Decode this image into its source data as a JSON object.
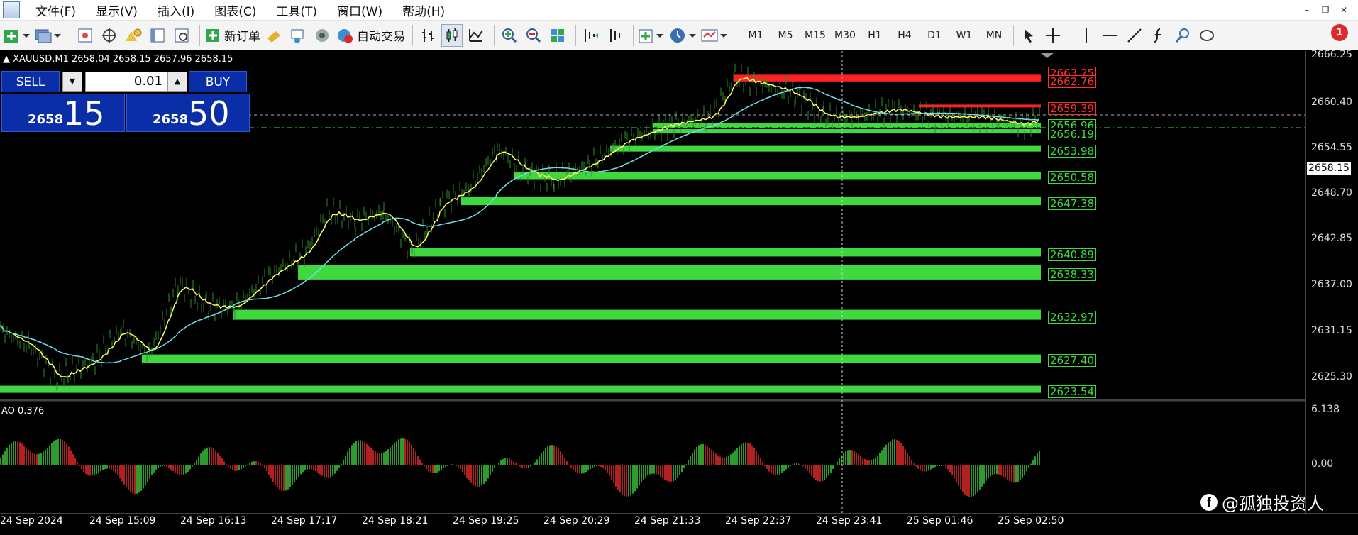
{
  "menu": {
    "items": [
      "文件(F)",
      "显示(V)",
      "插入(I)",
      "图表(C)",
      "工具(T)",
      "窗口(W)",
      "帮助(H)"
    ]
  },
  "toolbar": {
    "new_order_label": "新订单",
    "auto_trading_label": "自动交易",
    "timeframes": [
      "M1",
      "M5",
      "M15",
      "M30",
      "H1",
      "H4",
      "D1",
      "W1",
      "MN"
    ],
    "notification_count": "1"
  },
  "chart": {
    "symbol_line": "XAUUSD,M1  2658.04 2658.15 2657.96 2658.15",
    "current_price": "2658.15",
    "price_axis": [
      "2666.25",
      "2660.40",
      "2654.55",
      "2648.70",
      "2642.85",
      "2637.00",
      "2631.15",
      "2625.30"
    ],
    "ao_axis": [
      "6.138",
      "0.00"
    ],
    "ao_label": "AO 0.376",
    "time_axis": [
      "24 Sep 2024",
      "24 Sep 15:09",
      "24 Sep 16:13",
      "24 Sep 17:17",
      "24 Sep 18:21",
      "24 Sep 19:25",
      "24 Sep 20:29",
      "24 Sep 21:33",
      "24 Sep 22:37",
      "24 Sep 23:41",
      "25 Sep 01:46",
      "25 Sep 02:50"
    ],
    "support_levels": [
      "2653.98",
      "2650.58",
      "2647.38",
      "2640.89",
      "2638.33",
      "2632.97",
      "2627.40",
      "2623.54",
      "2656.96",
      "2656.19"
    ],
    "resistance_levels": [
      "2663.25",
      "2662.76",
      "2659.39"
    ],
    "colors": {
      "support": "#3fd93f",
      "resistance": "#ff2020",
      "ma_fast": "#ffff66",
      "ma_slow": "#6fe0e6",
      "candles": "#2e8b2e"
    }
  },
  "trade_panel": {
    "sell_label": "SELL",
    "buy_label": "BUY",
    "lot_value": "0.01",
    "sell_price_small": "2658",
    "sell_price_big": "15",
    "buy_price_small": "2658",
    "buy_price_big": "50"
  },
  "watermark": {
    "text": "@孤独投资人"
  }
}
